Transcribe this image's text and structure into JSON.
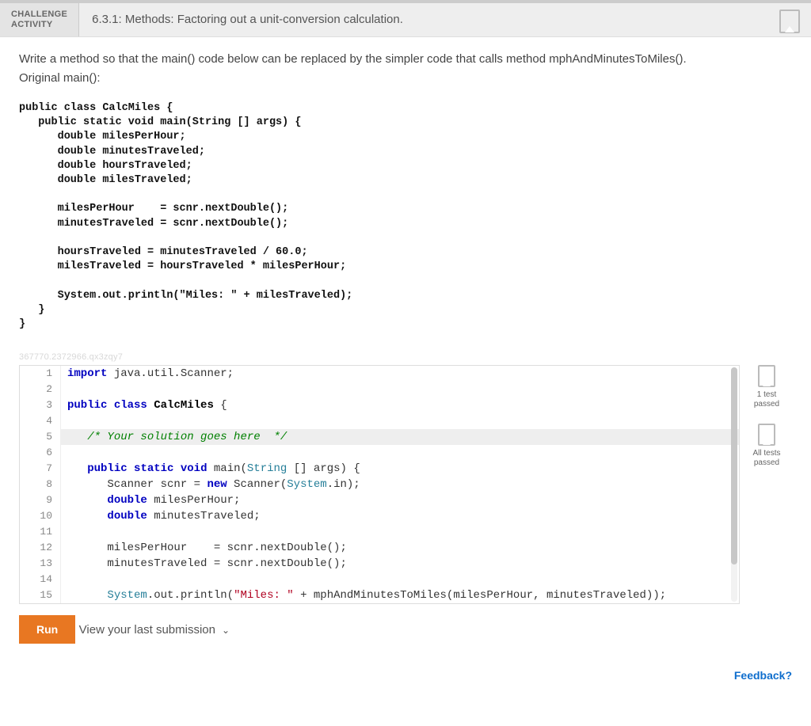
{
  "header": {
    "label_line1": "CHALLENGE",
    "label_line2": "ACTIVITY",
    "title": "6.3.1: Methods: Factoring out a unit-conversion calculation."
  },
  "instructions": {
    "line1": "Write a method so that the main() code below can be replaced by the simpler code that calls method mphAndMinutesToMiles().",
    "line2": "Original main():"
  },
  "static_code": "public class CalcMiles {\n   public static void main(String [] args) {\n      double milesPerHour;\n      double minutesTraveled;\n      double hoursTraveled;\n      double milesTraveled;\n\n      milesPerHour    = scnr.nextDouble();\n      minutesTraveled = scnr.nextDouble();\n\n      hoursTraveled = minutesTraveled / 60.0;\n      milesTraveled = hoursTraveled * milesPerHour;\n\n      System.out.println(\"Miles: \" + milesTraveled);\n   }\n}",
  "watermark": "367770.2372966.qx3zqy7",
  "editor": {
    "lines": [
      {
        "n": 1,
        "tokens": [
          [
            "kw",
            "import"
          ],
          [
            "",
            " java.util.Scanner;"
          ]
        ]
      },
      {
        "n": 2,
        "tokens": []
      },
      {
        "n": 3,
        "tokens": [
          [
            "kw",
            "public"
          ],
          [
            "",
            " "
          ],
          [
            "kw",
            "class"
          ],
          [
            "",
            " "
          ],
          [
            "cls",
            "CalcMiles"
          ],
          [
            "",
            " {"
          ]
        ]
      },
      {
        "n": 4,
        "tokens": []
      },
      {
        "n": 5,
        "hl": true,
        "tokens": [
          [
            "",
            "   "
          ],
          [
            "com",
            "/* Your solution goes here  */"
          ]
        ]
      },
      {
        "n": 6,
        "tokens": []
      },
      {
        "n": 7,
        "tokens": [
          [
            "",
            "   "
          ],
          [
            "kw",
            "public"
          ],
          [
            "",
            " "
          ],
          [
            "kw",
            "static"
          ],
          [
            "",
            " "
          ],
          [
            "kw",
            "void"
          ],
          [
            "",
            " main("
          ],
          [
            "type",
            "String"
          ],
          [
            "",
            " [] args) {"
          ]
        ]
      },
      {
        "n": 8,
        "tokens": [
          [
            "",
            "      Scanner scnr = "
          ],
          [
            "kw",
            "new"
          ],
          [
            "",
            " Scanner("
          ],
          [
            "type",
            "System"
          ],
          [
            "",
            ".in);"
          ]
        ]
      },
      {
        "n": 9,
        "tokens": [
          [
            "",
            "      "
          ],
          [
            "kw",
            "double"
          ],
          [
            "",
            " milesPerHour;"
          ]
        ]
      },
      {
        "n": 10,
        "tokens": [
          [
            "",
            "      "
          ],
          [
            "kw",
            "double"
          ],
          [
            "",
            " minutesTraveled;"
          ]
        ]
      },
      {
        "n": 11,
        "tokens": []
      },
      {
        "n": 12,
        "tokens": [
          [
            "",
            "      milesPerHour    = scnr.nextDouble();"
          ]
        ]
      },
      {
        "n": 13,
        "tokens": [
          [
            "",
            "      minutesTraveled = scnr.nextDouble();"
          ]
        ]
      },
      {
        "n": 14,
        "tokens": []
      },
      {
        "n": 15,
        "tokens": [
          [
            "",
            "      "
          ],
          [
            "type",
            "System"
          ],
          [
            "",
            ".out.println("
          ],
          [
            "str",
            "\"Miles: \""
          ],
          [
            "",
            " + mphAndMinutesToMiles(milesPerHour, minutesTraveled));"
          ]
        ]
      }
    ]
  },
  "status": [
    {
      "label": "1 test\npassed"
    },
    {
      "label": "All tests\npassed"
    }
  ],
  "run_label": "Run",
  "view_submission": "View your last submission",
  "feedback": "Feedback?"
}
